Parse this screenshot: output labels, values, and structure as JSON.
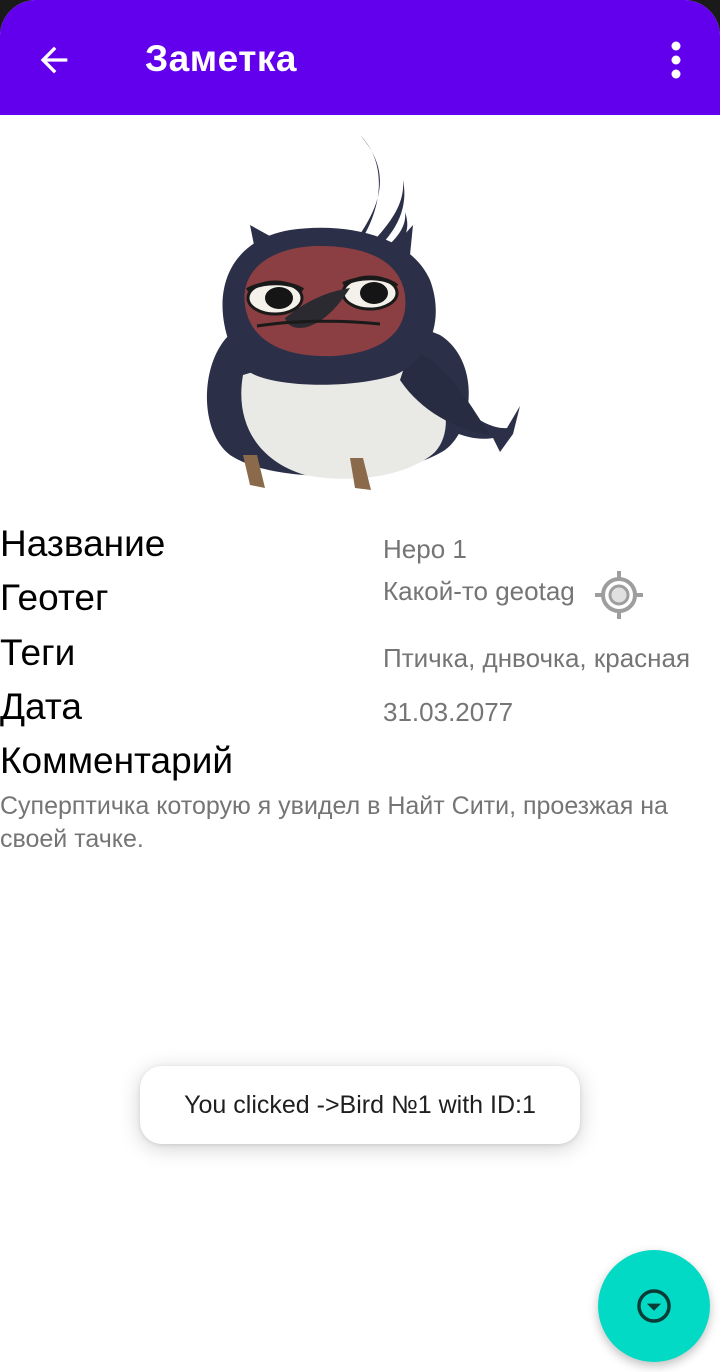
{
  "appbar": {
    "title": "Заметка",
    "back_icon": "arrow-back-icon",
    "menu_icon": "more-vert-icon",
    "color": "#6200ee"
  },
  "image": {
    "subject": "bird-illustration"
  },
  "fields": {
    "name_label": "Название",
    "name_value": "Неро 1",
    "geotag_label": "Геотег",
    "geotag_value": "Какой-то geotag",
    "geotag_icon": "gps-target-icon",
    "tags_label": "Теги",
    "tags_value": "Птичка, днвочка, красная",
    "date_label": "Дата",
    "date_value": "31.03.2077",
    "comment_label": "Комментарий",
    "comment_value": "Суперптичка которую я увидел в Найт Сити, проезжая на своей тачке."
  },
  "toast": {
    "message": "You clicked ->Bird №1 with ID:1"
  },
  "fab": {
    "icon": "arrow-drop-down-circle-icon",
    "color": "#03dac5"
  }
}
